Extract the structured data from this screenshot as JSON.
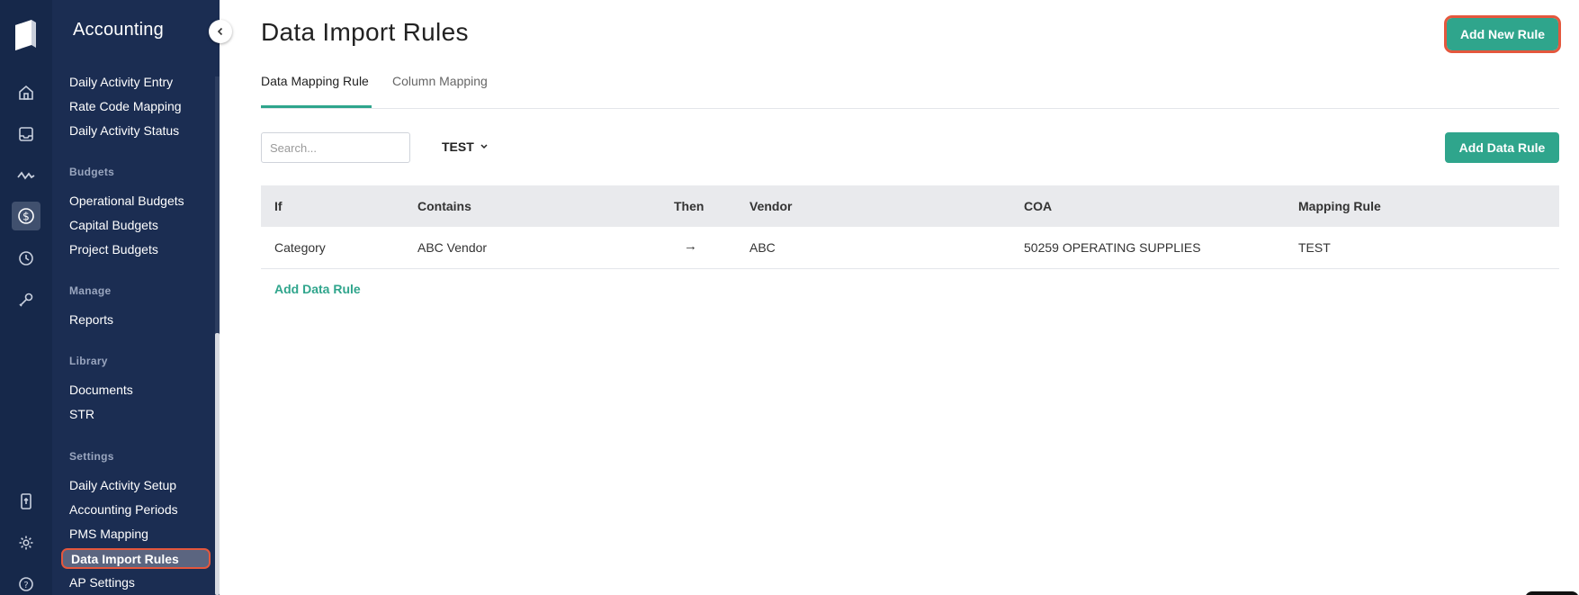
{
  "sidebar": {
    "title": "Accounting",
    "items_top": [
      "Daily Activity Entry",
      "Rate Code Mapping",
      "Daily Activity Status"
    ],
    "sections": {
      "budgets": "Budgets",
      "manage": "Manage",
      "library": "Library",
      "settings": "Settings"
    },
    "budgets": [
      "Operational Budgets",
      "Capital Budgets",
      "Project Budgets"
    ],
    "manage": [
      "Reports"
    ],
    "library": [
      "Documents",
      "STR"
    ],
    "settings": [
      "Daily Activity Setup",
      "Accounting Periods",
      "PMS Mapping",
      "Data Import Rules",
      "AP Settings"
    ]
  },
  "header": {
    "title": "Data Import Rules",
    "add_new_rule": "Add New Rule"
  },
  "tabs": [
    "Data Mapping Rule",
    "Column Mapping"
  ],
  "toolbar": {
    "search_placeholder": "Search...",
    "filter_value": "TEST",
    "add_data_rule": "Add Data Rule"
  },
  "table": {
    "columns": [
      "If",
      "Contains",
      "Then",
      "Vendor",
      "COA",
      "Mapping Rule"
    ],
    "rows": [
      {
        "if": "Category",
        "contains": "ABC Vendor",
        "then": "→",
        "vendor": "ABC",
        "coa": "50259 OPERATING SUPPLIES",
        "mapping_rule": "TEST"
      }
    ],
    "add_link": "Add Data Rule"
  },
  "colors": {
    "rail": "#16284a",
    "subnav": "#1b2d52",
    "accent": "#2fa58c",
    "highlight": "#e4573d"
  }
}
